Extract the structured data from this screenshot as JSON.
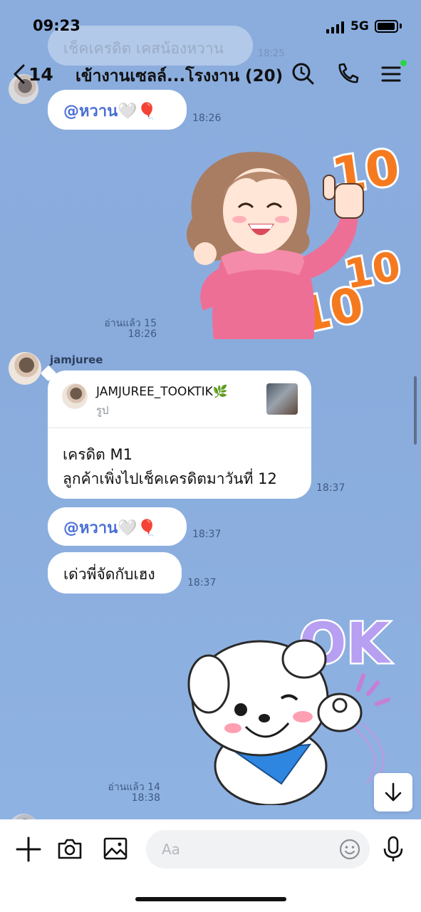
{
  "status_bar": {
    "time": "09:23",
    "network": "5G"
  },
  "header": {
    "back_count": "14",
    "title": "เข้างานเซลล์...โรงงาน (20)"
  },
  "faded_previous": {
    "text": "เช็คเครดิต เคสน้องหวาน"
  },
  "messages": [
    {
      "type": "text",
      "mention": "@หวาน",
      "emoji": "🤍🎈",
      "time": "18:26"
    },
    {
      "type": "sticker",
      "sticker": "girl-thumbs-up-10-10-10",
      "read": "อ่านแล้ว 15",
      "time": "18:26"
    },
    {
      "type": "quote",
      "sender": "jamjuree",
      "quoted_name": "JAMJUREE_TOOKTIK🌿",
      "quoted_subtitle": "รูป",
      "line1": "เครดิต M1",
      "line2": "ลูกค้าเพิ่งไปเช็คเครดิตมาวันที่ 12",
      "time": "18:37"
    },
    {
      "type": "text",
      "mention": "@หวาน",
      "emoji": "🤍🎈",
      "time": "18:37"
    },
    {
      "type": "text",
      "text": "เด่วพี่จัดกับเฮง",
      "time": "18:37"
    },
    {
      "type": "sticker",
      "sticker": "white-puppy-ok",
      "sticker_text": "OK",
      "read": "อ่านแล้ว 14",
      "time": "18:38"
    }
  ],
  "input": {
    "placeholder": "Aa"
  },
  "colors": {
    "background": "#8aaedf",
    "mention": "#4a6fd6",
    "online_dot": "#2bd44a"
  }
}
